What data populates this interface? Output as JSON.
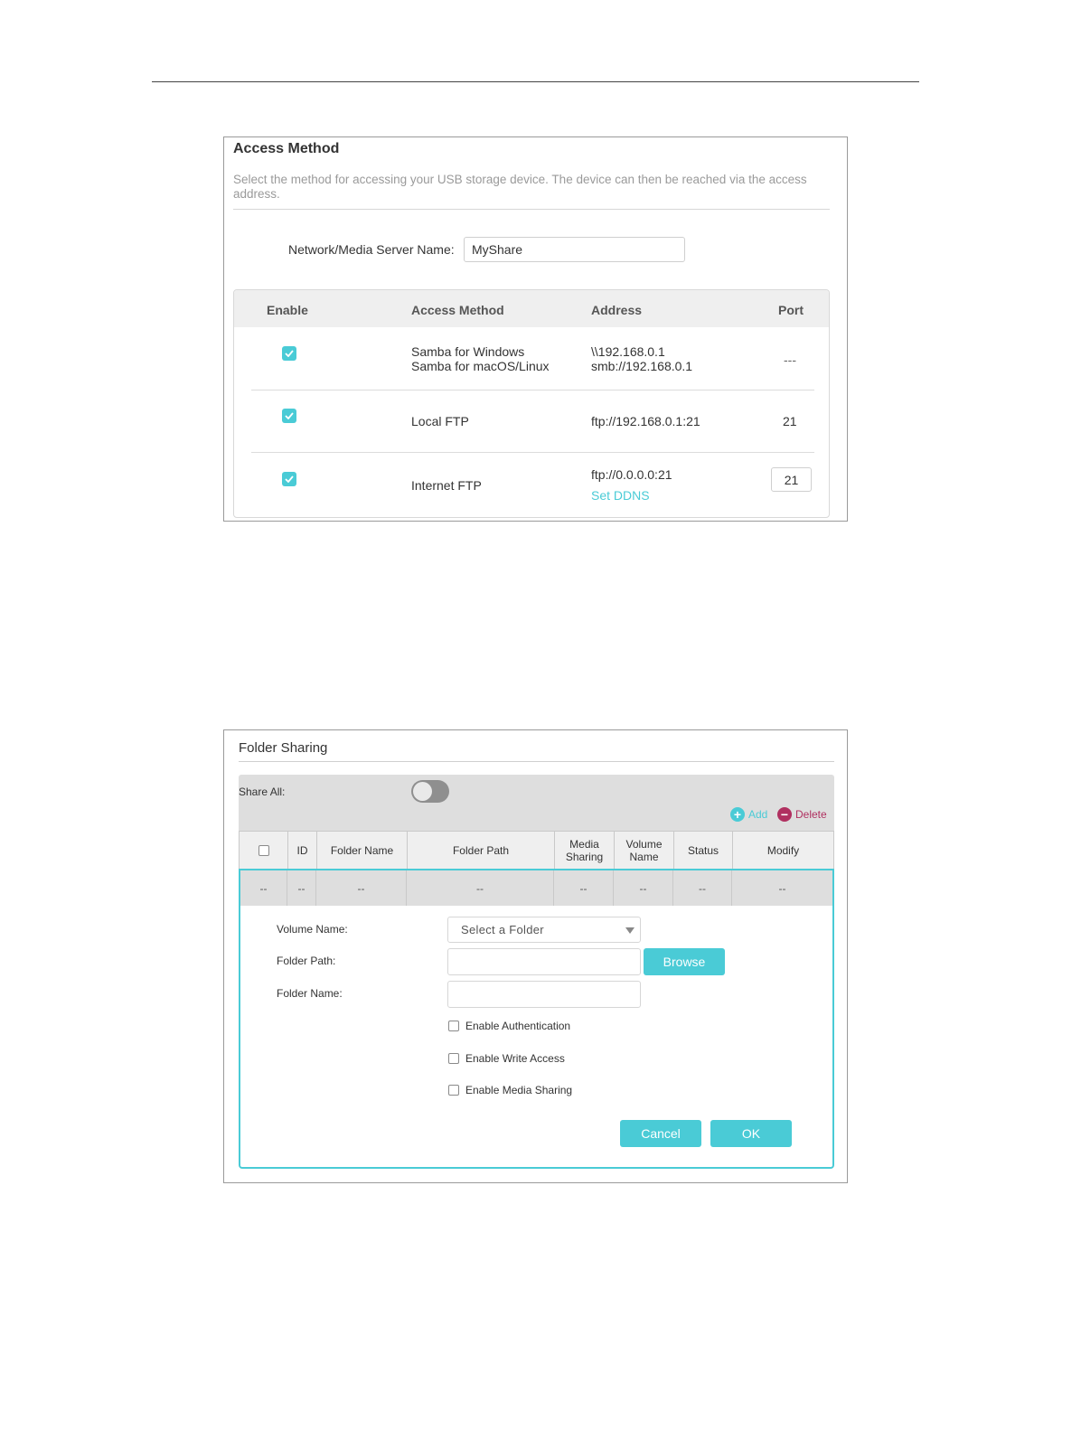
{
  "access_method": {
    "title": "Access Method",
    "description": "Select the method for accessing your USB storage device. The device can then be reached via the access address.",
    "server_name_label": "Network/Media Server Name:",
    "server_name_value": "MyShare",
    "columns": [
      "Enable",
      "Access Method",
      "Address",
      "Port"
    ],
    "rows": [
      {
        "enabled": true,
        "method_line1": "Samba for Windows",
        "method_line2": "Samba for macOS/Linux",
        "address_line1": "\\\\192.168.0.1",
        "address_line2": "smb://192.168.0.1",
        "port": "---"
      },
      {
        "enabled": true,
        "method": "Local FTP",
        "address": "ftp://192.168.0.1:21",
        "port": "21"
      },
      {
        "enabled": true,
        "method": "Internet FTP",
        "address": "ftp://0.0.0.0:21",
        "link": "Set DDNS",
        "port": "21"
      }
    ],
    "accent_color": "#4acbd6"
  },
  "folder_sharing": {
    "title": "Folder Sharing",
    "share_all_label": "Share All:",
    "share_all_on": false,
    "add_label": "Add",
    "delete_label": "Delete",
    "columns": {
      "id": "ID",
      "folder_name": "Folder Name",
      "folder_path": "Folder Path",
      "media_sharing_1": "Media",
      "media_sharing_2": "Sharing",
      "volume_name_1": "Volume",
      "volume_name_2": "Name",
      "status": "Status",
      "modify": "Modify"
    },
    "empty_row": [
      "--",
      "--",
      "--",
      "--",
      "--",
      "--",
      "--",
      "--"
    ],
    "form": {
      "volume_label": "Volume Name:",
      "volume_select": "Select a Folder",
      "path_label": "Folder Path:",
      "path_value": "",
      "browse_label": "Browse",
      "name_label": "Folder Name:",
      "name_value": "",
      "enable_auth": "Enable Authentication",
      "enable_write": "Enable Write Access",
      "enable_media": "Enable Media Sharing",
      "cancel_label": "Cancel",
      "ok_label": "OK"
    },
    "accent_color": "#4acbd6",
    "delete_color": "#b03060"
  }
}
